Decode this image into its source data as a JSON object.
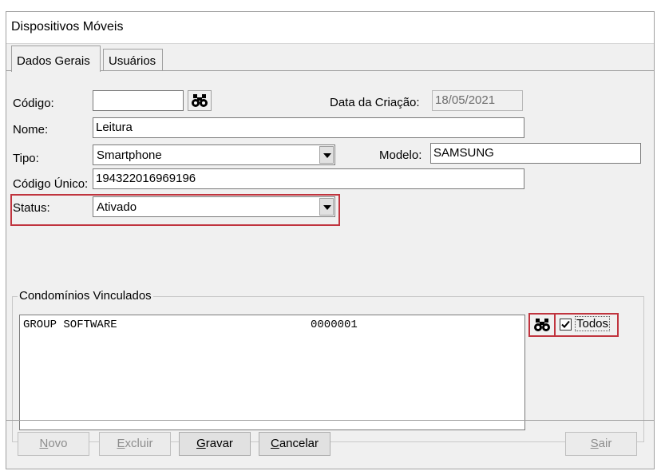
{
  "window": {
    "title": "Dispositivos Móveis"
  },
  "tabs": [
    {
      "label": "Dados Gerais",
      "active": true
    },
    {
      "label": "Usuários",
      "active": false
    }
  ],
  "form": {
    "codigo": {
      "label": "Código:",
      "value": ""
    },
    "data_criacao": {
      "label": "Data da Criação:",
      "value": "18/05/2021"
    },
    "nome": {
      "label": "Nome:",
      "value": "Leitura"
    },
    "tipo": {
      "label": "Tipo:",
      "value": "Smartphone"
    },
    "modelo": {
      "label": "Modelo:",
      "value": "SAMSUNG"
    },
    "codigo_unico": {
      "label": "Código Único:",
      "value": "194322016969196"
    },
    "status": {
      "label": "Status:",
      "value": "Ativado"
    }
  },
  "condominios": {
    "legend": "Condomínios Vinculados",
    "rows": [
      {
        "name": "GROUP SOFTWARE",
        "code": "0000001"
      }
    ],
    "todos_label": "Todos",
    "todos_checked": true
  },
  "buttons": {
    "novo": {
      "first": "N",
      "rest": "ovo",
      "enabled": false
    },
    "excluir": {
      "first": "E",
      "rest": "xcluir",
      "enabled": false
    },
    "gravar": {
      "first": "G",
      "rest": "ravar",
      "enabled": true
    },
    "cancelar": {
      "first": "C",
      "rest": "ancelar",
      "enabled": true
    },
    "sair": {
      "first": "S",
      "rest": "air",
      "enabled": false
    }
  },
  "icons": {
    "search": "binoculars-icon",
    "check": "checkmark-icon",
    "dropdown": "chevron-down-icon"
  },
  "colors": {
    "highlight": "#c0343e",
    "window_bg": "#f0f0f0"
  }
}
